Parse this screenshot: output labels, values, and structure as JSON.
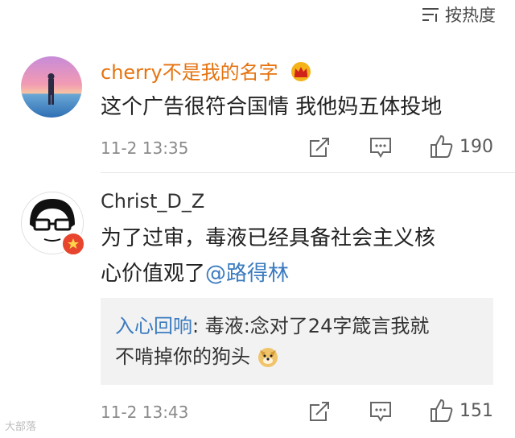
{
  "sort": {
    "label": "按热度",
    "icon": "sort-lines-icon"
  },
  "comments": [
    {
      "user": "cherry不是我的名字",
      "vip_badge": "crown-icon",
      "text": "这个广告很符合国情 我他妈五体投地",
      "time": "11-2 13:35",
      "likes": "190",
      "avatar": "beach-sunset-avatar"
    },
    {
      "user": "Christ_D_Z",
      "text_line1": "为了过审，毒液已经具备社会主义核",
      "text_line2_prefix": "心价值观了",
      "mention": "@路得林",
      "reply": {
        "user": "入心回响",
        "colon": ": ",
        "line1": "毒液:念对了24字箴言我就",
        "line2": "不啃掉你的狗头"
      },
      "time": "11-2 13:43",
      "likes": "151",
      "avatar": "cartoon-glasses-avatar",
      "badge": "verified-badge-icon"
    }
  ],
  "watermark": "大部落"
}
